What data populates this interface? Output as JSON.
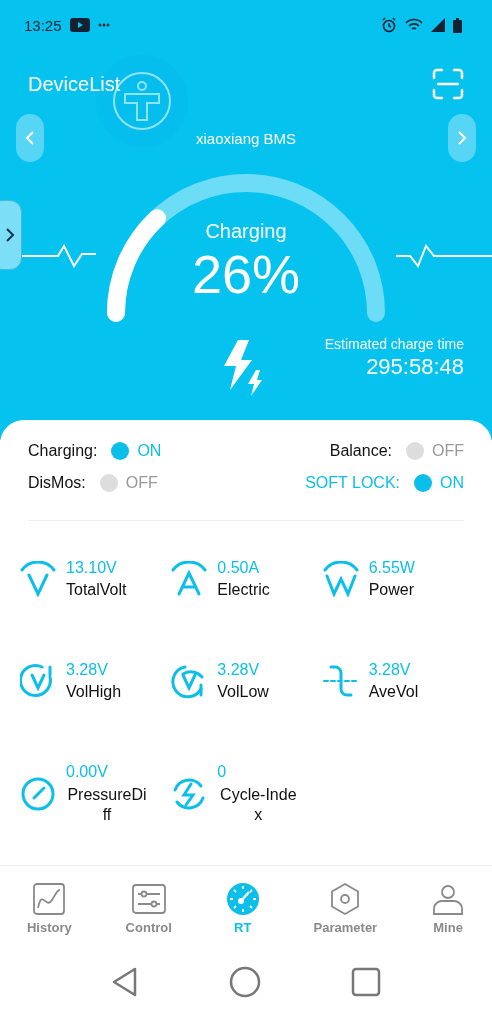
{
  "status_bar": {
    "time": "13:25"
  },
  "header": {
    "title": "DeviceList",
    "device": "xiaoxiang BMS"
  },
  "gauge": {
    "label": "Charging",
    "percent": "26%"
  },
  "charge_time": {
    "label": "Estimated charge time",
    "value": "295:58:48"
  },
  "switches": [
    {
      "label": "Charging:",
      "state": "ON",
      "on": true,
      "highlighted": false
    },
    {
      "label": "Balance:",
      "state": "OFF",
      "on": false,
      "highlighted": false
    },
    {
      "label": "DisMos:",
      "state": "OFF",
      "on": false,
      "highlighted": false
    },
    {
      "label": "SOFT LOCK:",
      "state": "ON",
      "on": true,
      "highlighted": true
    }
  ],
  "metrics": [
    {
      "kind": "volt",
      "value": "13.10V",
      "label": "TotalVolt"
    },
    {
      "kind": "amp",
      "value": "0.50A",
      "label": "Electric"
    },
    {
      "kind": "watt",
      "value": "6.55W",
      "label": "Power"
    },
    {
      "kind": "vol-high",
      "value": "3.28V",
      "label": "VolHigh"
    },
    {
      "kind": "vol-low",
      "value": "3.28V",
      "label": "VolLow"
    },
    {
      "kind": "average",
      "value": "3.28V",
      "label": "AveVol"
    },
    {
      "kind": "diff",
      "value": "0.00V",
      "label": "PressureDiff"
    },
    {
      "kind": "cycle",
      "value": "0",
      "label": "Cycle-Index"
    }
  ],
  "tabs": [
    {
      "kind": "history",
      "label": "History",
      "selected": false
    },
    {
      "kind": "control",
      "label": "Control",
      "selected": false
    },
    {
      "kind": "rt",
      "label": "RT",
      "selected": true
    },
    {
      "kind": "parameter",
      "label": "Parameter",
      "selected": false
    },
    {
      "kind": "mine",
      "label": "Mine",
      "selected": false
    }
  ]
}
